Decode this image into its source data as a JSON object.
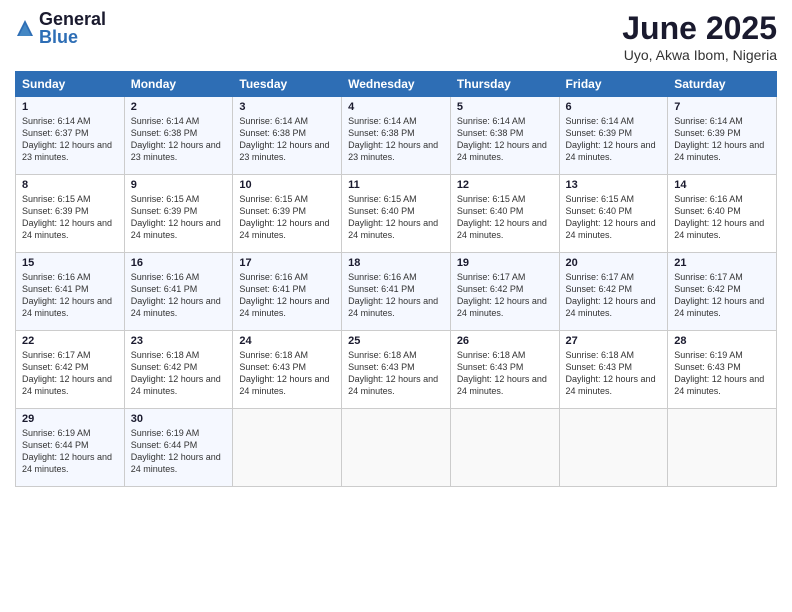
{
  "logo": {
    "general": "General",
    "blue": "Blue"
  },
  "title": "June 2025",
  "subtitle": "Uyo, Akwa Ibom, Nigeria",
  "days": [
    "Sunday",
    "Monday",
    "Tuesday",
    "Wednesday",
    "Thursday",
    "Friday",
    "Saturday"
  ],
  "weeks": [
    [
      {
        "num": "1",
        "sunrise": "6:14 AM",
        "sunset": "6:37 PM",
        "daylight": "12 hours and 23 minutes."
      },
      {
        "num": "2",
        "sunrise": "6:14 AM",
        "sunset": "6:38 PM",
        "daylight": "12 hours and 23 minutes."
      },
      {
        "num": "3",
        "sunrise": "6:14 AM",
        "sunset": "6:38 PM",
        "daylight": "12 hours and 23 minutes."
      },
      {
        "num": "4",
        "sunrise": "6:14 AM",
        "sunset": "6:38 PM",
        "daylight": "12 hours and 23 minutes."
      },
      {
        "num": "5",
        "sunrise": "6:14 AM",
        "sunset": "6:38 PM",
        "daylight": "12 hours and 24 minutes."
      },
      {
        "num": "6",
        "sunrise": "6:14 AM",
        "sunset": "6:39 PM",
        "daylight": "12 hours and 24 minutes."
      },
      {
        "num": "7",
        "sunrise": "6:14 AM",
        "sunset": "6:39 PM",
        "daylight": "12 hours and 24 minutes."
      }
    ],
    [
      {
        "num": "8",
        "sunrise": "6:15 AM",
        "sunset": "6:39 PM",
        "daylight": "12 hours and 24 minutes."
      },
      {
        "num": "9",
        "sunrise": "6:15 AM",
        "sunset": "6:39 PM",
        "daylight": "12 hours and 24 minutes."
      },
      {
        "num": "10",
        "sunrise": "6:15 AM",
        "sunset": "6:39 PM",
        "daylight": "12 hours and 24 minutes."
      },
      {
        "num": "11",
        "sunrise": "6:15 AM",
        "sunset": "6:40 PM",
        "daylight": "12 hours and 24 minutes."
      },
      {
        "num": "12",
        "sunrise": "6:15 AM",
        "sunset": "6:40 PM",
        "daylight": "12 hours and 24 minutes."
      },
      {
        "num": "13",
        "sunrise": "6:15 AM",
        "sunset": "6:40 PM",
        "daylight": "12 hours and 24 minutes."
      },
      {
        "num": "14",
        "sunrise": "6:16 AM",
        "sunset": "6:40 PM",
        "daylight": "12 hours and 24 minutes."
      }
    ],
    [
      {
        "num": "15",
        "sunrise": "6:16 AM",
        "sunset": "6:41 PM",
        "daylight": "12 hours and 24 minutes."
      },
      {
        "num": "16",
        "sunrise": "6:16 AM",
        "sunset": "6:41 PM",
        "daylight": "12 hours and 24 minutes."
      },
      {
        "num": "17",
        "sunrise": "6:16 AM",
        "sunset": "6:41 PM",
        "daylight": "12 hours and 24 minutes."
      },
      {
        "num": "18",
        "sunrise": "6:16 AM",
        "sunset": "6:41 PM",
        "daylight": "12 hours and 24 minutes."
      },
      {
        "num": "19",
        "sunrise": "6:17 AM",
        "sunset": "6:42 PM",
        "daylight": "12 hours and 24 minutes."
      },
      {
        "num": "20",
        "sunrise": "6:17 AM",
        "sunset": "6:42 PM",
        "daylight": "12 hours and 24 minutes."
      },
      {
        "num": "21",
        "sunrise": "6:17 AM",
        "sunset": "6:42 PM",
        "daylight": "12 hours and 24 minutes."
      }
    ],
    [
      {
        "num": "22",
        "sunrise": "6:17 AM",
        "sunset": "6:42 PM",
        "daylight": "12 hours and 24 minutes."
      },
      {
        "num": "23",
        "sunrise": "6:18 AM",
        "sunset": "6:42 PM",
        "daylight": "12 hours and 24 minutes."
      },
      {
        "num": "24",
        "sunrise": "6:18 AM",
        "sunset": "6:43 PM",
        "daylight": "12 hours and 24 minutes."
      },
      {
        "num": "25",
        "sunrise": "6:18 AM",
        "sunset": "6:43 PM",
        "daylight": "12 hours and 24 minutes."
      },
      {
        "num": "26",
        "sunrise": "6:18 AM",
        "sunset": "6:43 PM",
        "daylight": "12 hours and 24 minutes."
      },
      {
        "num": "27",
        "sunrise": "6:18 AM",
        "sunset": "6:43 PM",
        "daylight": "12 hours and 24 minutes."
      },
      {
        "num": "28",
        "sunrise": "6:19 AM",
        "sunset": "6:43 PM",
        "daylight": "12 hours and 24 minutes."
      }
    ],
    [
      {
        "num": "29",
        "sunrise": "6:19 AM",
        "sunset": "6:44 PM",
        "daylight": "12 hours and 24 minutes."
      },
      {
        "num": "30",
        "sunrise": "6:19 AM",
        "sunset": "6:44 PM",
        "daylight": "12 hours and 24 minutes."
      },
      null,
      null,
      null,
      null,
      null
    ]
  ]
}
